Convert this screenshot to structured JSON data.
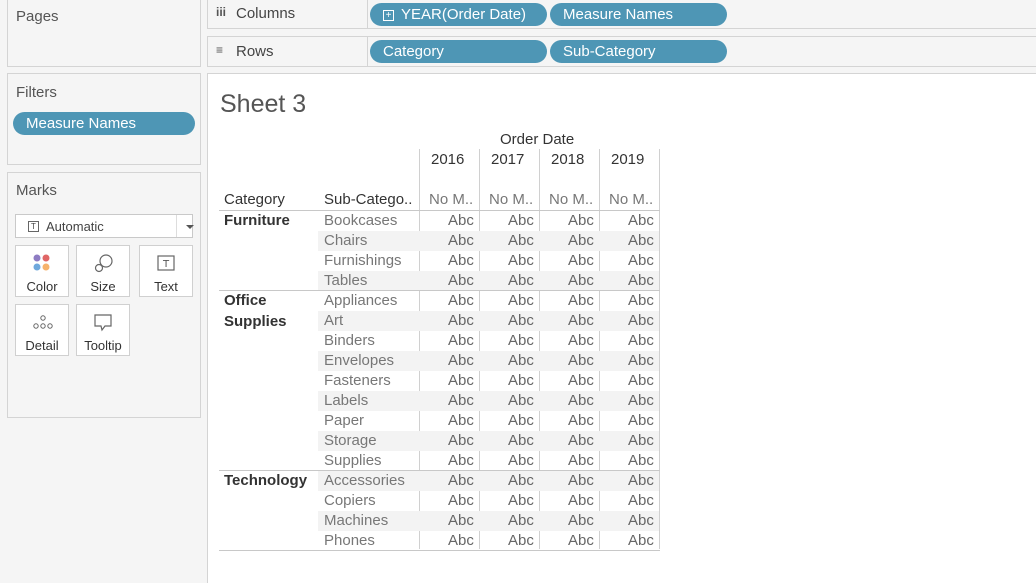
{
  "left_panel": {
    "pages_title": "Pages",
    "filters_title": "Filters",
    "filter_pill": "Measure Names",
    "marks_title": "Marks",
    "marks_type": "Automatic",
    "mark_buttons": {
      "color": "Color",
      "size": "Size",
      "text": "Text",
      "detail": "Detail",
      "tooltip": "Tooltip"
    }
  },
  "shelves": {
    "columns_label": "Columns",
    "columns_pills": [
      "YEAR(Order Date)",
      "Measure Names"
    ],
    "rows_label": "Rows",
    "rows_pills": [
      "Category",
      "Sub-Category"
    ]
  },
  "sheet": {
    "title": "Sheet 3",
    "column_group_header": "Order Date",
    "years": [
      "2016",
      "2017",
      "2018",
      "2019"
    ],
    "category_header": "Category",
    "subcategory_header": "Sub-Catego..",
    "measure_header": "No M..",
    "cell_text": "Abc",
    "categories": [
      {
        "name": "Furniture",
        "subcategories": [
          "Bookcases",
          "Chairs",
          "Furnishings",
          "Tables"
        ]
      },
      {
        "name": "Office Supplies",
        "subcategories": [
          "Appliances",
          "Art",
          "Binders",
          "Envelopes",
          "Fasteners",
          "Labels",
          "Paper",
          "Storage",
          "Supplies"
        ]
      },
      {
        "name": "Technology",
        "subcategories": [
          "Accessories",
          "Copiers",
          "Machines",
          "Phones"
        ]
      }
    ]
  },
  "colors": {
    "pill": "#4e96b5",
    "band": "#f3f3f3",
    "panel": "#f5f5f5"
  }
}
